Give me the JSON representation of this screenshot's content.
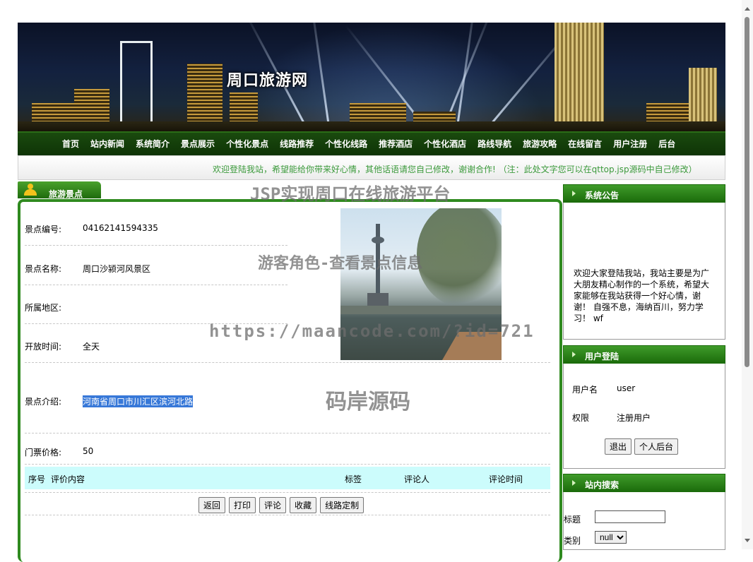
{
  "site": {
    "title": "周口旅游网"
  },
  "nav": {
    "items": [
      "首页",
      "站内新闻",
      "系统简介",
      "景点展示",
      "个性化景点",
      "线路推荐",
      "个性化线路",
      "推荐酒店",
      "个性化酒店",
      "路线导航",
      "旅游攻略",
      "在线留言",
      "用户注册",
      "后台"
    ]
  },
  "notice_bar": {
    "text": "欢迎登陆我站，希望能给你带来好心情，其他话语请您自己修改，谢谢合作!  （注：此处文字您可以在qttop.jsp源码中自己修改）"
  },
  "scenic": {
    "tab_label": "旅游景点",
    "fields": {
      "id": {
        "label": "景点编号:",
        "value": "04162141594335"
      },
      "name": {
        "label": "景点名称:",
        "value": "周口沙颍河风景区"
      },
      "region": {
        "label": "所属地区:",
        "value": ""
      },
      "open_time": {
        "label": "开放时间:",
        "value": "全天"
      },
      "intro": {
        "label": "景点介绍:",
        "value": "河南省周口市川汇区滨河北路"
      },
      "price": {
        "label": "门票价格:",
        "value": "50"
      }
    },
    "comments": {
      "headers": {
        "index": "序号",
        "content": "评价内容",
        "tag": "标签",
        "commenter": "评论人",
        "time": "评论时间"
      }
    },
    "buttons": {
      "back": "返回",
      "print": "打印",
      "comment": "评论",
      "favorite": "收藏",
      "route": "线路定制"
    }
  },
  "sidebar": {
    "announcement": {
      "title": "系统公告",
      "text": "欢迎大家登陆我站，我站主要是为广大朋友精心制作的一个系统，希望大家能够在我站获得一个好心情，谢谢！ 自强不息，海纳百川，努力学习！ wf"
    },
    "login": {
      "title": "用户登陆",
      "username_label": "用户名",
      "username_value": "user",
      "role_label": "权限",
      "role_value": "注册用户",
      "logout_label": "退出",
      "profile_label": "个人后台"
    },
    "search": {
      "title": "站内搜索",
      "title_label": "标题",
      "title_value": "",
      "category_label": "类别",
      "category_selected": "null"
    }
  },
  "watermarks": {
    "line1": "JSP实现周口在线旅游平台",
    "line2": "游客角色-查看景点信息",
    "line3": "https://maancode.com/?id=721",
    "line4": "码岸源码"
  }
}
